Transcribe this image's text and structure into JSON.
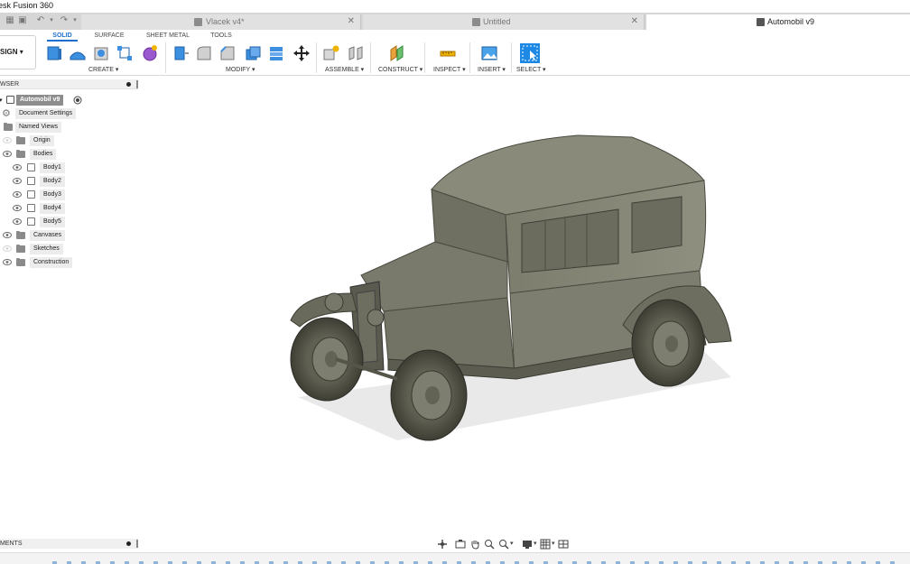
{
  "app": {
    "title": "esk Fusion 360"
  },
  "tabs": [
    {
      "label": "Vlacek v4*",
      "active": false
    },
    {
      "label": "Untitled",
      "active": false
    },
    {
      "label": "Automobil v9",
      "active": true
    }
  ],
  "toolbar": {
    "workspace": "SIGN ▾",
    "workspace_tabs": [
      "SOLID",
      "SURFACE",
      "SHEET METAL",
      "TOOLS"
    ],
    "groups": [
      "CREATE ▾",
      "MODIFY ▾",
      "ASSEMBLE ▾",
      "CONSTRUCT ▾",
      "INSPECT ▾",
      "INSERT ▾",
      "SELECT ▾"
    ]
  },
  "browser": {
    "title": "WSER",
    "root": "Automobil v9",
    "items": [
      {
        "label": "Document Settings"
      },
      {
        "label": "Named Views"
      },
      {
        "label": "Origin"
      },
      {
        "label": "Bodies"
      },
      {
        "label": "Body1"
      },
      {
        "label": "Body2"
      },
      {
        "label": "Body3"
      },
      {
        "label": "Body4"
      },
      {
        "label": "Body5"
      },
      {
        "label": "Canvases"
      },
      {
        "label": "Sketches"
      },
      {
        "label": "Construction"
      }
    ]
  },
  "comments": {
    "title": "MENTS"
  },
  "colors": {
    "accent": "#1c6fd1",
    "model": "#787868"
  }
}
